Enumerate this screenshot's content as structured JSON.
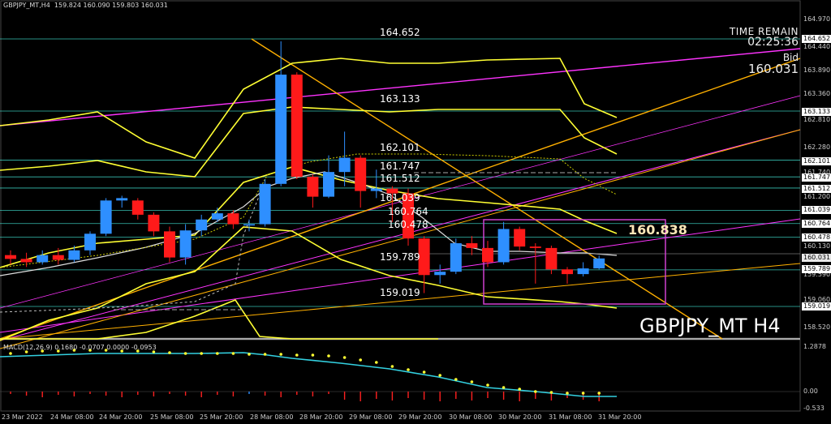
{
  "header": {
    "symbol_info": "GBPJPY_MT,H4  159.824 160.090 159.803 160.031"
  },
  "overlay": {
    "time_remain_label": "TIME REMAIN",
    "time_remain_value": "02:25:36",
    "bid_label": "Bid",
    "bid_value": "160.031",
    "symbol_watermark": "GBPJPY_MT H4",
    "highlight_level": "160.838"
  },
  "level_labels": [
    "164.652",
    "163.133",
    "162.101",
    "161.747",
    "161.512",
    "161.039",
    "160.764",
    "160.478",
    "159.789",
    "159.019"
  ],
  "price_axis_ticks": [
    "164.970",
    "164.440",
    "163.890",
    "163.360",
    "162.810",
    "162.280",
    "161.740",
    "161.200",
    "160.670",
    "160.130",
    "159.590",
    "159.060",
    "158.520"
  ],
  "price_tags": [
    "164.652",
    "163.133",
    "162.101",
    "161.747",
    "161.512",
    "161.039",
    "160.764",
    "160.478",
    "159.789",
    "159.019"
  ],
  "current_price_tag": "160.031",
  "macd": {
    "label": "MACD(12,26,9) 0.1680 -0.0707 0.0000 -0.0953",
    "axis_top": "1.2878",
    "axis_zero": "0.00",
    "axis_bottom": "-0.533"
  },
  "time_axis": [
    "23 Mar 2022",
    "24 Mar 08:00",
    "24 Mar 20:00",
    "25 Mar 08:00",
    "25 Mar 20:00",
    "28 Mar 08:00",
    "28 Mar 20:00",
    "29 Mar 08:00",
    "29 Mar 20:00",
    "30 Mar 08:00",
    "30 Mar 20:00",
    "31 Mar 08:00",
    "31 Mar 20:00"
  ],
  "colors": {
    "bull": "#2e8fff",
    "bear": "#ff1a1a",
    "band": "#ffff33",
    "trend_magenta": "#ff33ff",
    "trend_orange": "#ffb000",
    "level_line": "#40e0d0",
    "box": "#d040d0"
  },
  "candles": [
    {
      "o": 160.1,
      "c": 160.02,
      "h": 160.2,
      "l": 159.9
    },
    {
      "o": 160.02,
      "c": 159.95,
      "h": 160.15,
      "l": 159.85
    },
    {
      "o": 159.95,
      "c": 160.1,
      "h": 160.2,
      "l": 159.9
    },
    {
      "o": 160.1,
      "c": 160.0,
      "h": 160.25,
      "l": 159.9
    },
    {
      "o": 160.0,
      "c": 160.2,
      "h": 160.3,
      "l": 159.95
    },
    {
      "o": 160.2,
      "c": 160.55,
      "h": 160.6,
      "l": 160.1
    },
    {
      "o": 160.55,
      "c": 161.25,
      "h": 161.3,
      "l": 160.5
    },
    {
      "o": 161.25,
      "c": 161.3,
      "h": 161.35,
      "l": 161.1
    },
    {
      "o": 161.25,
      "c": 160.95,
      "h": 161.3,
      "l": 160.85
    },
    {
      "o": 160.95,
      "c": 160.6,
      "h": 161.0,
      "l": 160.5
    },
    {
      "o": 160.6,
      "c": 160.05,
      "h": 160.7,
      "l": 159.95
    },
    {
      "o": 160.05,
      "c": 160.62,
      "h": 160.75,
      "l": 159.9
    },
    {
      "o": 160.62,
      "c": 160.85,
      "h": 160.95,
      "l": 160.5
    },
    {
      "o": 160.85,
      "c": 160.98,
      "h": 161.1,
      "l": 160.8
    },
    {
      "o": 160.98,
      "c": 160.75,
      "h": 161.05,
      "l": 160.65
    },
    {
      "o": 160.75,
      "c": 160.75,
      "h": 160.85,
      "l": 160.6
    },
    {
      "o": 160.75,
      "c": 161.6,
      "h": 161.7,
      "l": 160.7
    },
    {
      "o": 161.6,
      "c": 163.9,
      "h": 164.6,
      "l": 161.55
    },
    {
      "o": 163.9,
      "c": 161.75,
      "h": 163.95,
      "l": 161.7
    },
    {
      "o": 161.75,
      "c": 161.33,
      "h": 161.8,
      "l": 161.1
    },
    {
      "o": 161.33,
      "c": 161.85,
      "h": 162.2,
      "l": 161.3
    },
    {
      "o": 161.85,
      "c": 162.15,
      "h": 162.7,
      "l": 161.55
    },
    {
      "o": 162.15,
      "c": 161.45,
      "h": 162.2,
      "l": 161.1
    },
    {
      "o": 161.45,
      "c": 161.5,
      "h": 161.9,
      "l": 161.3
    },
    {
      "o": 161.5,
      "c": 161.4,
      "h": 161.55,
      "l": 160.8
    },
    {
      "o": 161.4,
      "c": 160.45,
      "h": 161.5,
      "l": 160.3
    },
    {
      "o": 160.45,
      "c": 159.68,
      "h": 160.5,
      "l": 159.3
    },
    {
      "o": 159.68,
      "c": 159.75,
      "h": 159.9,
      "l": 159.5
    },
    {
      "o": 159.75,
      "c": 160.35,
      "h": 160.45,
      "l": 159.7
    },
    {
      "o": 160.35,
      "c": 160.25,
      "h": 160.5,
      "l": 160.1
    },
    {
      "o": 160.25,
      "c": 159.95,
      "h": 160.4,
      "l": 159.85
    },
    {
      "o": 159.95,
      "c": 160.65,
      "h": 160.8,
      "l": 159.9
    },
    {
      "o": 160.65,
      "c": 160.28,
      "h": 160.7,
      "l": 160.2
    },
    {
      "o": 160.28,
      "c": 160.25,
      "h": 160.35,
      "l": 159.5
    },
    {
      "o": 160.25,
      "c": 159.8,
      "h": 160.3,
      "l": 159.7
    },
    {
      "o": 159.8,
      "c": 159.7,
      "h": 159.85,
      "l": 159.5
    },
    {
      "o": 159.7,
      "c": 159.82,
      "h": 159.95,
      "l": 159.65
    },
    {
      "o": 159.82,
      "c": 160.03,
      "h": 160.09,
      "l": 159.8
    }
  ]
}
